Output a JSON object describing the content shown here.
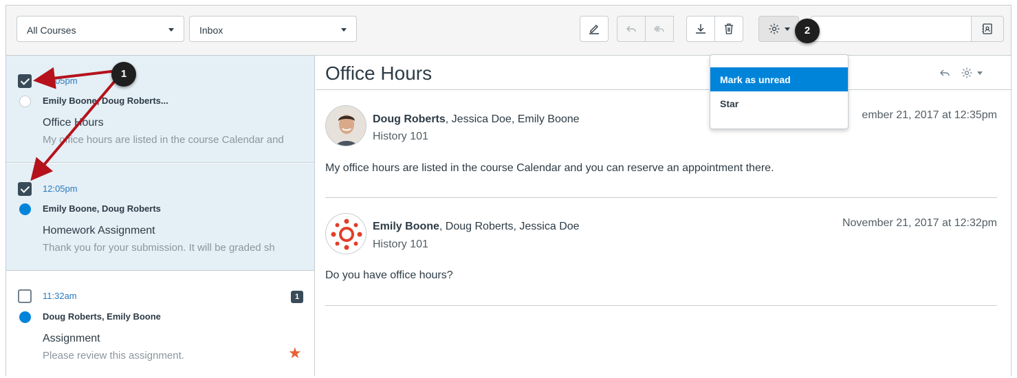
{
  "toolbar": {
    "course_filter": "All Courses",
    "mailbox_filter": "Inbox",
    "buttons": [
      "compose-icon",
      "reply-icon",
      "reply-all-icon",
      "archive-icon",
      "delete-icon",
      "settings-icon"
    ],
    "search_placeholder": ""
  },
  "gear_menu": {
    "items": [
      "Mark as unread",
      "Star"
    ]
  },
  "conversations": [
    {
      "time": "12:05pm",
      "participants": "Emily Boone, Doug Roberts...",
      "subject": "Office Hours",
      "preview": "My office hours are listed in the course Calendar and",
      "checked": true,
      "unread": false
    },
    {
      "time": "12:05pm",
      "participants": "Emily Boone, Doug Roberts",
      "subject": "Homework Assignment",
      "preview": "Thank you for your submission. It will be graded sh",
      "checked": true,
      "unread": true
    },
    {
      "time": "11:32am",
      "participants": "Doug Roberts, Emily Boone",
      "subject": "Assignment",
      "preview": "Please review this assignment.",
      "checked": false,
      "unread": true,
      "count": "1",
      "starred": true
    }
  ],
  "conversation": {
    "subject": "Office Hours",
    "messages": [
      {
        "author": "Doug Roberts",
        "others": ", Jessica Doe, Emily Boone",
        "course": "History 101",
        "date": "ember 21, 2017 at 12:35pm",
        "body": "My office hours are listed in the course Calendar and you can reserve an appointment there."
      },
      {
        "author": "Emily Boone",
        "others": ", Doug Roberts, Jessica Doe",
        "course": "History 101",
        "date": "November 21, 2017 at 12:32pm",
        "body": "Do you have office hours?"
      }
    ]
  },
  "callouts": [
    "1",
    "2"
  ],
  "colors": {
    "accent": "#0084da",
    "link": "#2b7abc",
    "selected_bg": "#e4eff6",
    "star": "#e66135",
    "arrow": "#b5121b"
  }
}
